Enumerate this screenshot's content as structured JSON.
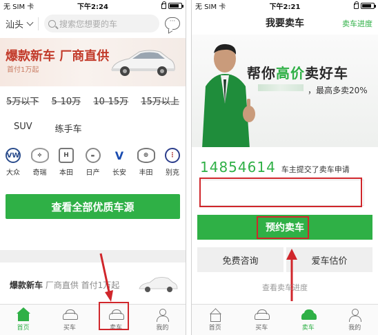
{
  "left_phone": {
    "status": {
      "carrier": "无 SIM 卡",
      "time": "下午2:24"
    },
    "search": {
      "city": "汕头",
      "placeholder": "搜索您想要的车"
    },
    "banner": {
      "title": "爆款新车  厂商直供",
      "subtitle": "首付1万起"
    },
    "price_filters": [
      "5万以下",
      "5-10万",
      "10-15万",
      "15万以上"
    ],
    "type_filters": [
      "SUV",
      "练手车"
    ],
    "brands": [
      {
        "name": "大众",
        "icon": "volkswagen-logo-icon"
      },
      {
        "name": "奇瑞",
        "icon": "chery-logo-icon"
      },
      {
        "name": "本田",
        "icon": "honda-logo-icon"
      },
      {
        "name": "日产",
        "icon": "nissan-logo-icon"
      },
      {
        "name": "长安",
        "icon": "changan-logo-icon"
      },
      {
        "name": "丰田",
        "icon": "toyota-logo-icon"
      },
      {
        "name": "别克",
        "icon": "buick-logo-icon"
      }
    ],
    "all_cars_button": "查看全部优质车源",
    "promo": {
      "title": "爆款新车",
      "sub": "厂商直供  首付1万起"
    },
    "tabs": [
      "首页",
      "买车",
      "卖车",
      "我的"
    ],
    "active_tab": "首页"
  },
  "right_phone": {
    "status": {
      "carrier": "无 SIM 卡",
      "time": "下午2:21"
    },
    "header": {
      "title": "我要卖车",
      "progress_link": "卖车进度"
    },
    "hero": {
      "slogan_pre": "帮你",
      "slogan_green": "高价",
      "slogan_post": "卖好车",
      "sub": "，最高多卖20%"
    },
    "counter": {
      "number": "14854614",
      "text": "车主提交了卖车申请"
    },
    "phone_input_value": "",
    "book_button": "预约卖车",
    "consult_button": "免费咨询",
    "estimate_button": "爱车估价",
    "check_progress": "查看卖车进度",
    "tabs": [
      "首页",
      "买车",
      "卖车",
      "我的"
    ],
    "active_tab": "卖车"
  },
  "colors": {
    "green": "#2fb046",
    "highlight_red": "#d0262b"
  }
}
